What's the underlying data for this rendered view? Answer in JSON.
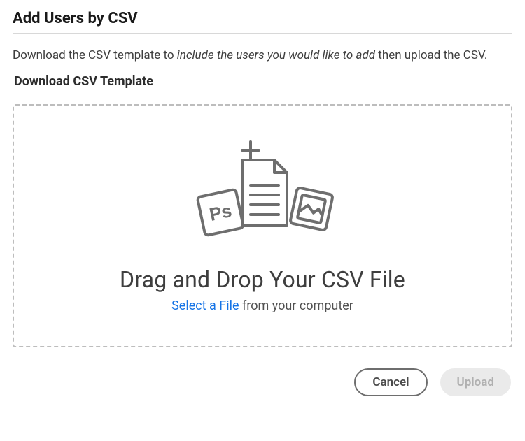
{
  "dialog": {
    "title": "Add Users by CSV",
    "instruction_prefix": "Download the CSV template to ",
    "instruction_emphasis": "include the users you would like to add",
    "instruction_suffix": " then upload the CSV.",
    "download_link": "Download CSV Template"
  },
  "dropzone": {
    "heading": "Drag and Drop Your CSV File",
    "select_link": "Select a File",
    "sub_suffix": " from your computer"
  },
  "buttons": {
    "cancel": "Cancel",
    "upload": "Upload"
  }
}
